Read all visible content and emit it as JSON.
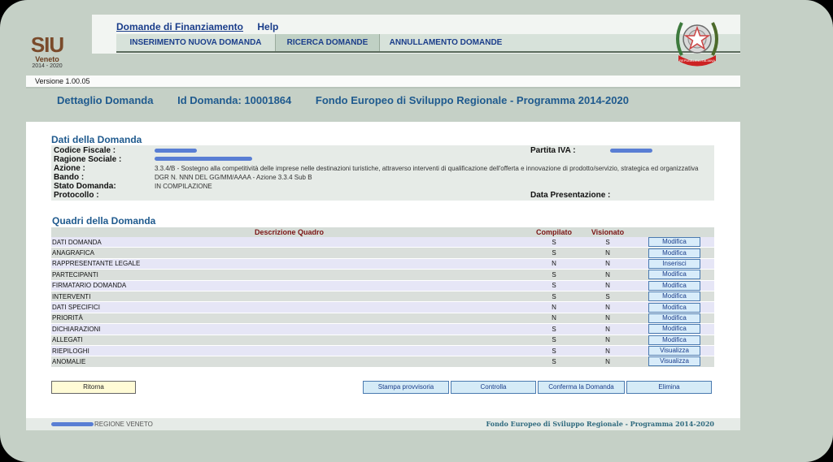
{
  "brand": {
    "name": "SIU",
    "region": "Veneto",
    "years": "2014 - 2020"
  },
  "top_links": {
    "domande": "Domande di Finanziamento",
    "help": "Help"
  },
  "nav": {
    "items": [
      "INSERIMENTO NUOVA DOMANDA",
      "RICERCA DOMANDE",
      "ANNULLAMENTO DOMANDE"
    ],
    "active_index": 1
  },
  "emblem": {
    "icon": "italian-republic-emblem-icon",
    "text": "REPUBBLICA ITALIANA"
  },
  "version": "Versione 1.00.05",
  "title": {
    "dettaglio": "Dettaglio Domanda",
    "id": "Id Domanda: 10001864",
    "fondo": "Fondo Europeo di Sviluppo Regionale - Programma 2014-2020"
  },
  "dati": {
    "section_title": "Dati della Domanda",
    "labels": {
      "codice_fiscale": "Codice Fiscale :",
      "ragione_sociale": "Ragione Sociale :",
      "azione": "Azione :",
      "bando": "Bando :",
      "stato": "Stato Domanda:",
      "protocollo": "Protocollo :",
      "partita_iva": "Partita IVA :",
      "data_presentazione": "Data Presentazione :"
    },
    "values": {
      "azione": "3.3.4/B - Sostegno alla competitività delle imprese nelle destinazioni turistiche, attraverso interventi di qualificazione dell'offerta e innovazione di prodotto/servizio, strategica ed organizzativa",
      "bando": "DGR N. NNN DEL GG/MM/AAAA - Azione 3.3.4 Sub B",
      "stato": "IN COMPILAZIONE"
    }
  },
  "quadri": {
    "section_title": "Quadri della Domanda",
    "columns": {
      "descrizione": "Descrizione Quadro",
      "compilato": "Compilato",
      "visionato": "Visionato"
    },
    "rows": [
      {
        "name": "DATI DOMANDA",
        "compilato": "S",
        "visionato": "S",
        "action": "Modifica"
      },
      {
        "name": "ANAGRAFICA",
        "compilato": "S",
        "visionato": "N",
        "action": "Modifica"
      },
      {
        "name": "RAPPRESENTANTE LEGALE",
        "compilato": "N",
        "visionato": "N",
        "action": "Inserisci"
      },
      {
        "name": "PARTECIPANTI",
        "compilato": "S",
        "visionato": "N",
        "action": "Modifica"
      },
      {
        "name": "FIRMATARIO DOMANDA",
        "compilato": "S",
        "visionato": "N",
        "action": "Modifica"
      },
      {
        "name": "INTERVENTI",
        "compilato": "S",
        "visionato": "S",
        "action": "Modifica"
      },
      {
        "name": "DATI SPECIFICI",
        "compilato": "N",
        "visionato": "N",
        "action": "Modifica"
      },
      {
        "name": "PRIORITÀ",
        "compilato": "N",
        "visionato": "N",
        "action": "Modifica"
      },
      {
        "name": "DICHIARAZIONI",
        "compilato": "S",
        "visionato": "N",
        "action": "Modifica"
      },
      {
        "name": "ALLEGATI",
        "compilato": "S",
        "visionato": "N",
        "action": "Modifica"
      },
      {
        "name": "RIEPILOGHI",
        "compilato": "S",
        "visionato": "N",
        "action": "Visualizza"
      },
      {
        "name": "ANOMALIE",
        "compilato": "S",
        "visionato": "N",
        "action": "Visualizza"
      }
    ]
  },
  "buttons": {
    "ritorna": "Ritorna",
    "stampa": "Stampa provvisoria",
    "controlla": "Controlla",
    "conferma": "Conferma la Domanda",
    "elimina": "Elimina"
  },
  "footer": {
    "left": "REGIONE VENETO",
    "right": "Fondo Europeo di Sviluppo Regionale - Programma 2014-2020"
  },
  "colors": {
    "accent": "#1f5a8e",
    "header_dark": "#7a1414",
    "background": "#c5d0c6"
  }
}
